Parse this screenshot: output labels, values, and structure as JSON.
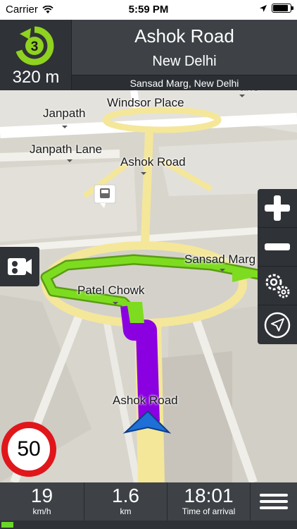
{
  "status_bar": {
    "carrier": "Carrier",
    "time": "5:59 PM"
  },
  "header": {
    "turn_exit": "3",
    "turn_distance": "320 m",
    "street": "Ashok Road",
    "city": "New Delhi",
    "next_street": "Sansad Marg, New Delhi"
  },
  "map": {
    "labels": {
      "windsor_place": "Windsor Place",
      "janpath": "Janpath",
      "janpath_lane": "Janpath Lane",
      "ashok_road_top": "Ashok Road",
      "sansad_marg": "Sansad Marg",
      "patel_chowk": "Patel Chowk",
      "ashok_road_bottom": "Ashok Road",
      "lane_fragment": "ane"
    },
    "speed_limit": "50"
  },
  "bottom_bar": {
    "speed": {
      "value": "19",
      "unit": "km/h"
    },
    "distance": {
      "value": "1.6",
      "unit": "km"
    },
    "arrival": {
      "value": "18:01",
      "unit": "Time of arrival"
    }
  },
  "route_progress": 0.04,
  "battery_level": 0.9,
  "colors": {
    "route_active": "#8b00e0",
    "route_upcoming": "#7ddc1f",
    "speed_sign_border": "#e0161b",
    "turn_icon": "#8fd21f"
  }
}
